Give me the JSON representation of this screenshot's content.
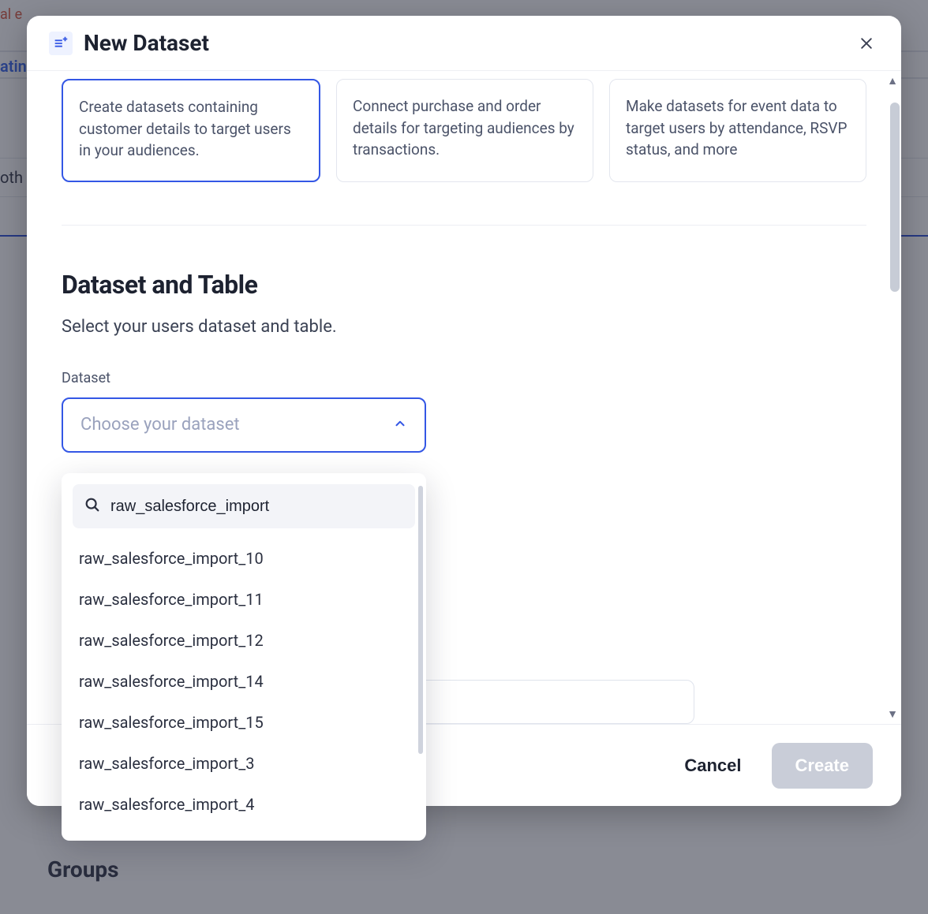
{
  "background": {
    "banner_fragment": "al e",
    "tab_fragment": "atin",
    "row_fragment": "oth",
    "groups_heading": "Groups"
  },
  "modal": {
    "title": "New Dataset",
    "cards": [
      {
        "text": "Create datasets containing customer details to target users in your audiences.",
        "selected": true
      },
      {
        "text": "Connect purchase and order details for targeting audiences by transactions.",
        "selected": false
      },
      {
        "text": "Make datasets for event data to target users by attendance, RSVP status, and more",
        "selected": false
      }
    ],
    "section": {
      "title": "Dataset and Table",
      "subtitle": "Select your users dataset and table."
    },
    "dataset_field": {
      "label": "Dataset",
      "placeholder": "Choose your dataset"
    },
    "dropdown": {
      "search_value": "raw_salesforce_import",
      "options": [
        "raw_salesforce_import_10",
        "raw_salesforce_import_11",
        "raw_salesforce_import_12",
        "raw_salesforce_import_14",
        "raw_salesforce_import_15",
        "raw_salesforce_import_3",
        "raw_salesforce_import_4"
      ]
    },
    "footer": {
      "cancel": "Cancel",
      "create": "Create"
    }
  }
}
